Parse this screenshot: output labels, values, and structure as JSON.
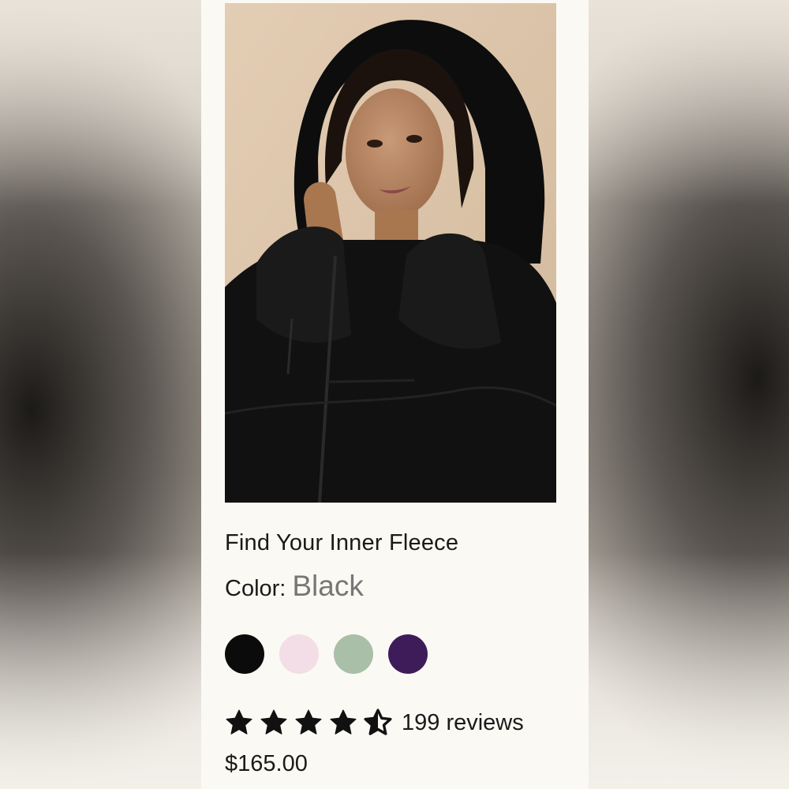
{
  "product": {
    "title": "Find Your Inner Fleece",
    "color_label": "Color:",
    "color_value": "Black",
    "swatches": [
      {
        "name": "Black",
        "hex": "#0b0b0b"
      },
      {
        "name": "Pink",
        "hex": "#f3dde6"
      },
      {
        "name": "Sage",
        "hex": "#a9bfa8"
      },
      {
        "name": "Purple",
        "hex": "#3e1c5a"
      }
    ],
    "rating": 4.5,
    "reviews_label": "199 reviews",
    "price": "$165.00"
  }
}
